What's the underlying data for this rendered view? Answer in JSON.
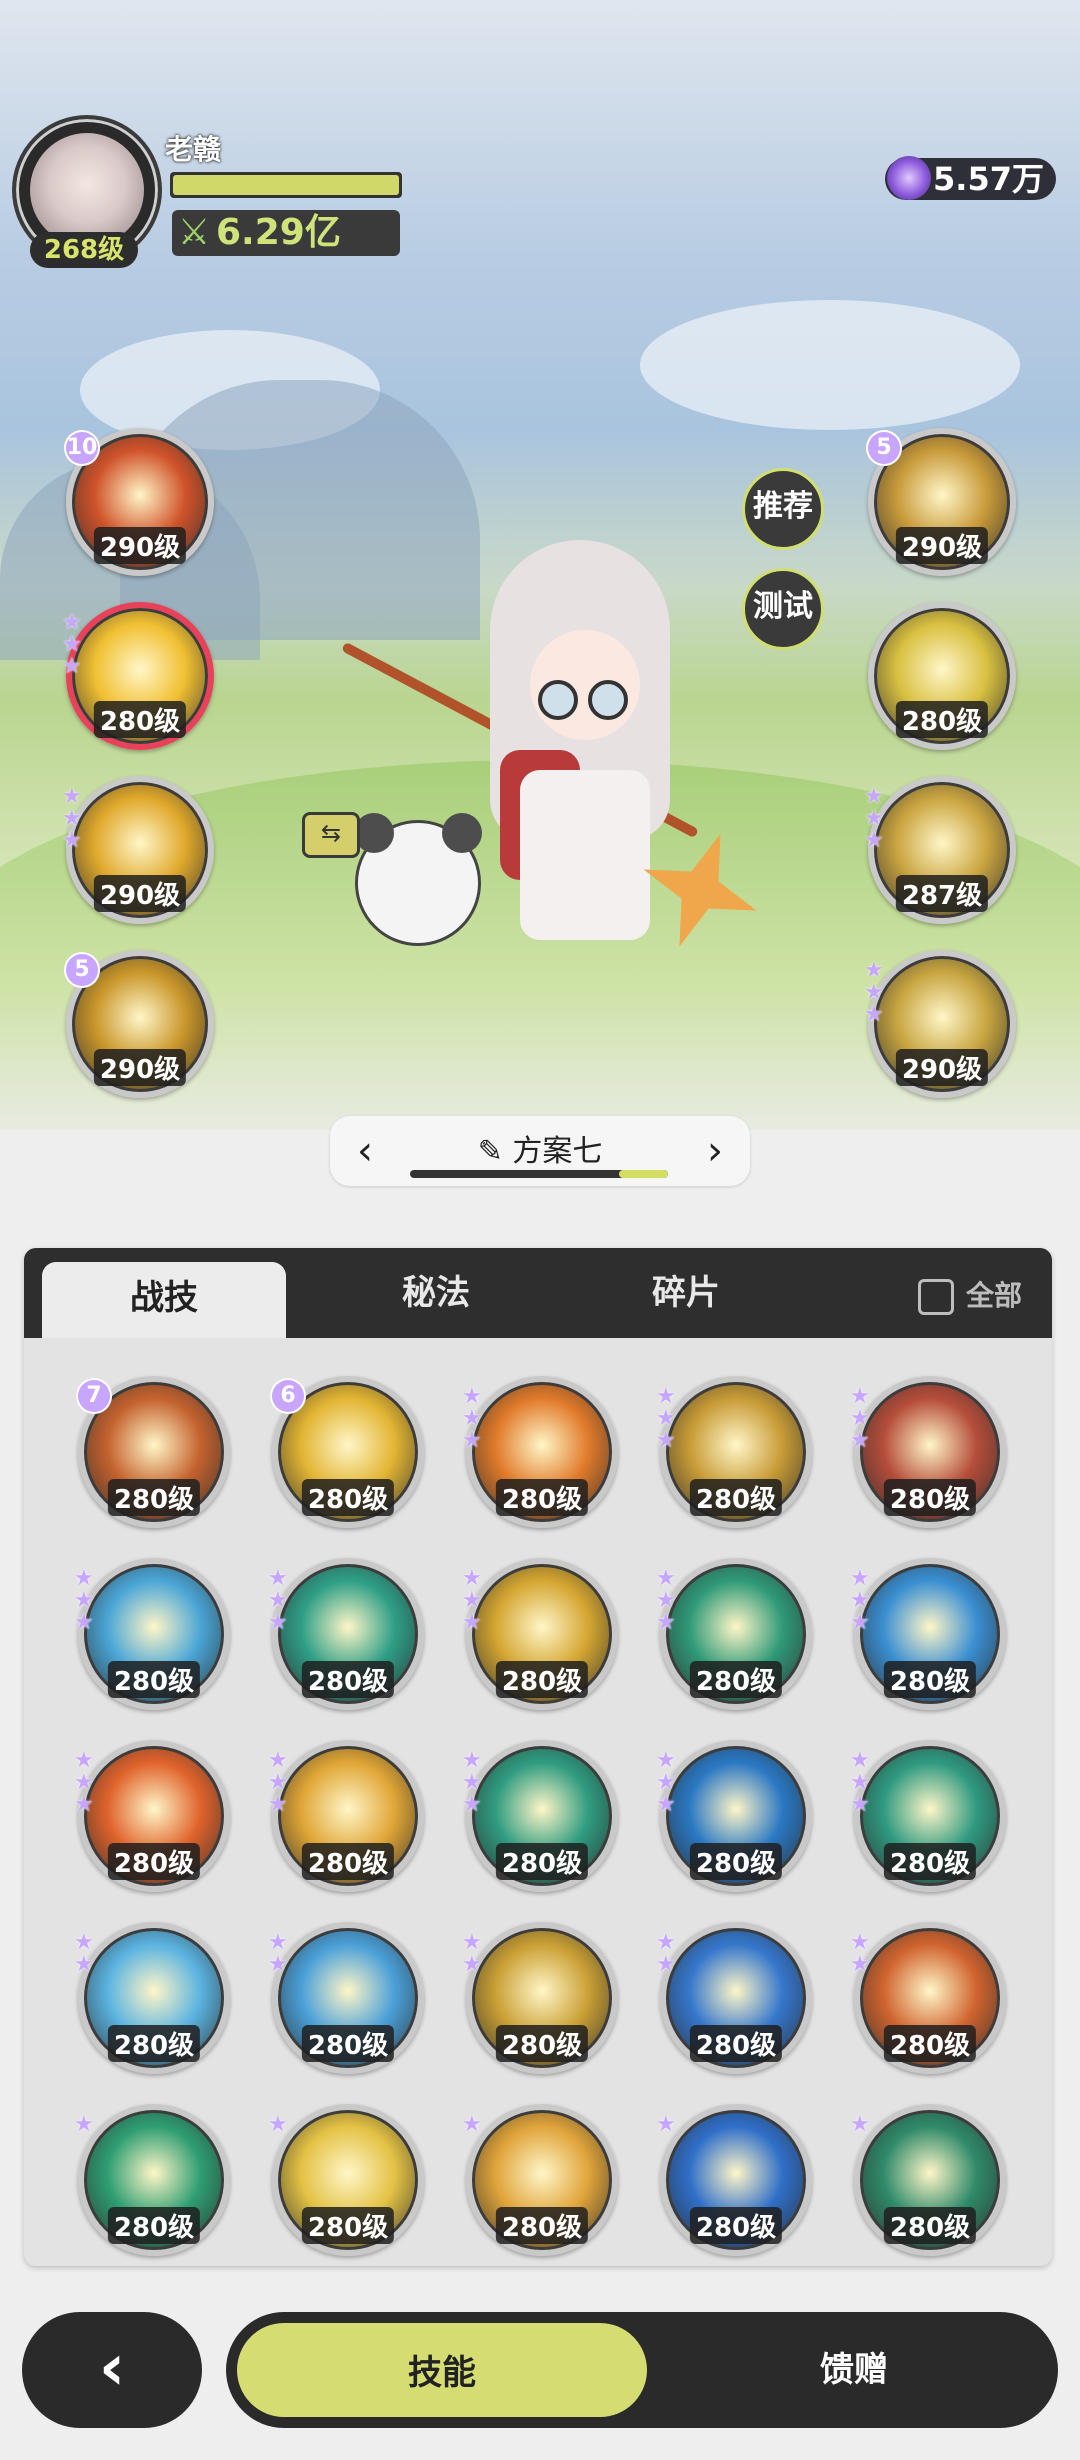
{
  "player": {
    "name": "老赣",
    "level": "268级",
    "power": "6.29亿",
    "currency": "5.57万"
  },
  "side_buttons": {
    "recommend": "推荐",
    "test": "测试"
  },
  "left_skills": [
    {
      "level": "290级",
      "badge": "10",
      "stars": 0,
      "color": "#d0532a"
    },
    {
      "level": "280级",
      "badge": "",
      "stars": 3,
      "color": "#f1c032",
      "red": true
    },
    {
      "level": "290级",
      "badge": "",
      "stars": 3,
      "color": "#e0a92c"
    },
    {
      "level": "290级",
      "badge": "5",
      "stars": 0,
      "color": "#c9962a"
    }
  ],
  "right_skills": [
    {
      "level": "290级",
      "badge": "5",
      "stars": 0,
      "color": "#c89a3a"
    },
    {
      "level": "280级",
      "badge": "",
      "stars": 0,
      "color": "#d8c040"
    },
    {
      "level": "287级",
      "badge": "",
      "stars": 3,
      "color": "#caa540"
    },
    {
      "level": "290级",
      "badge": "",
      "stars": 3,
      "color": "#c7a540"
    }
  ],
  "plan": {
    "title": "方案七",
    "prev_icon": "chevron-left-icon",
    "next_icon": "chevron-right-icon",
    "edit_icon": "pencil-icon",
    "progress": 0.19
  },
  "tabs": [
    {
      "label": "战技",
      "active": true
    },
    {
      "label": "秘法"
    },
    {
      "label": "碎片"
    }
  ],
  "all_label": "全部",
  "grid": [
    {
      "level": "280级",
      "badge": "7",
      "stars": 0,
      "color": "#c4622e"
    },
    {
      "level": "280级",
      "badge": "6",
      "stars": 0,
      "color": "#e2b533"
    },
    {
      "level": "280级",
      "badge": "",
      "stars": 3,
      "color": "#e07a2a"
    },
    {
      "level": "280级",
      "badge": "",
      "stars": 3,
      "color": "#c79b36"
    },
    {
      "level": "280级",
      "badge": "",
      "stars": 3,
      "color": "#b54d3a"
    },
    {
      "level": "280级",
      "badge": "",
      "stars": 3,
      "color": "#4aa6d6"
    },
    {
      "level": "280级",
      "badge": "",
      "stars": 3,
      "color": "#2e9f86"
    },
    {
      "level": "280级",
      "badge": "",
      "stars": 3,
      "color": "#d4a631"
    },
    {
      "level": "280级",
      "badge": "",
      "stars": 3,
      "color": "#2f9a78"
    },
    {
      "level": "280级",
      "badge": "",
      "stars": 3,
      "color": "#3a8fd2"
    },
    {
      "level": "280级",
      "badge": "",
      "stars": 3,
      "color": "#e0632c"
    },
    {
      "level": "280级",
      "badge": "",
      "stars": 3,
      "color": "#e0a636"
    },
    {
      "level": "280级",
      "badge": "",
      "stars": 3,
      "color": "#2f9c80"
    },
    {
      "level": "280级",
      "badge": "",
      "stars": 3,
      "color": "#2a78c3"
    },
    {
      "level": "280级",
      "badge": "",
      "stars": 3,
      "color": "#2f9a80"
    },
    {
      "level": "280级",
      "badge": "",
      "stars": 2,
      "color": "#5ab3e0"
    },
    {
      "level": "280级",
      "badge": "",
      "stars": 2,
      "color": "#4aa0d8"
    },
    {
      "level": "280级",
      "badge": "",
      "stars": 2,
      "color": "#caa035"
    },
    {
      "level": "280级",
      "badge": "",
      "stars": 2,
      "color": "#3577cc"
    },
    {
      "level": "280级",
      "badge": "",
      "stars": 2,
      "color": "#d0642f"
    },
    {
      "level": "280级",
      "badge": "",
      "stars": 1,
      "color": "#2e9e72"
    },
    {
      "level": "280级",
      "badge": "",
      "stars": 1,
      "color": "#e3c244"
    },
    {
      "level": "280级",
      "badge": "",
      "stars": 1,
      "color": "#e0a43a"
    },
    {
      "level": "280级",
      "badge": "",
      "stars": 1,
      "color": "#2f6fc8"
    },
    {
      "level": "280级",
      "badge": "",
      "stars": 1,
      "color": "#2f8a6a"
    }
  ],
  "bottom": {
    "back_icon": "chevron-left-icon",
    "skills_label": "技能",
    "gift_label": "馈赠"
  }
}
